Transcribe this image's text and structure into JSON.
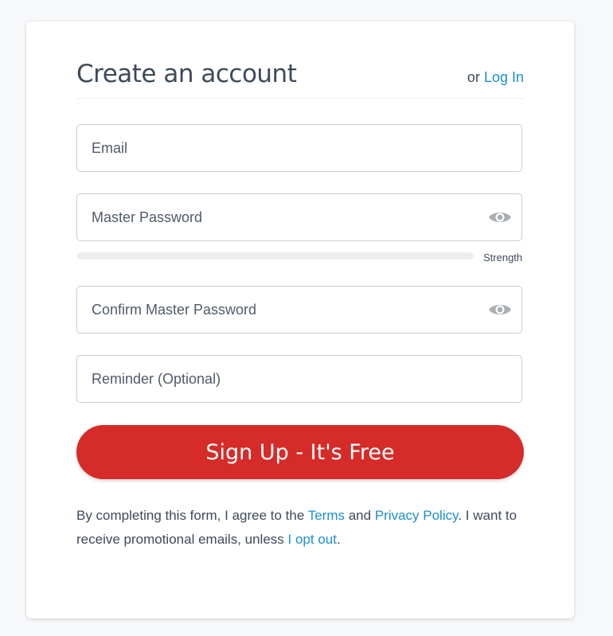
{
  "form": {
    "title": "Create an account",
    "login_prefix": "or",
    "login_link": "Log In",
    "email_placeholder": "Email",
    "password_placeholder": "Master Password",
    "strength_label": "Strength",
    "strength_level": 0,
    "confirm_placeholder": "Confirm Master Password",
    "reminder_placeholder": "Reminder (Optional)",
    "submit_label": "Sign Up - It's Free"
  },
  "legal": {
    "text_1": "By completing this form, I agree to the ",
    "terms_link": "Terms",
    "text_2": " and ",
    "privacy_link": "Privacy Policy",
    "text_3": ". I want to receive promotional emails, unless ",
    "optout_link": "I opt out",
    "text_4": "."
  },
  "icons": {
    "password_toggle": "eye-icon",
    "confirm_toggle": "eye-icon"
  },
  "colors": {
    "accent": "#d52b29",
    "link": "#1a8fd1",
    "text": "#3e4a5a",
    "background": "#f7f8fa"
  }
}
